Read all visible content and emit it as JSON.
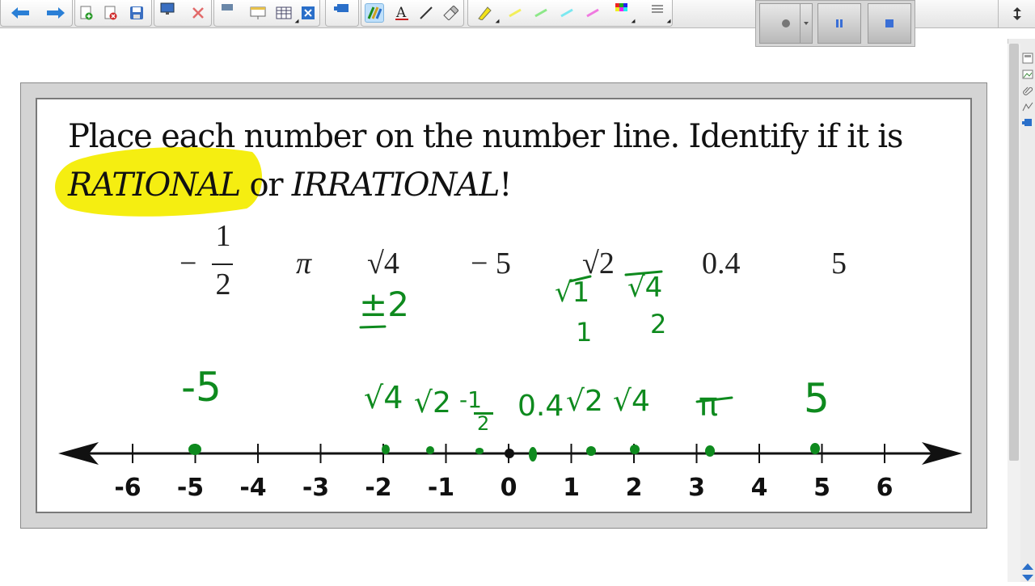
{
  "slide": {
    "title_line1": "Place each number on the number line. Identify if it is",
    "rational_word": "RATIONAL",
    "or_word": "or",
    "irrational_word": "IRRATIONAL",
    "exclamation": "!",
    "numbers": {
      "neg_half_sign": "−",
      "neg_half_num": "1",
      "neg_half_den": "2",
      "pi": "π",
      "sqrt4": "√4",
      "neg5": "− 5",
      "sqrt2": "√2",
      "zero_point_four": "0.4",
      "five": "5"
    },
    "number_line": {
      "tick_labels": [
        "-6",
        "-5",
        "-4",
        "-3",
        "-2",
        "-1",
        "0",
        "1",
        "2",
        "3",
        "4",
        "5",
        "6"
      ]
    },
    "handwriting": {
      "pm2": "±2",
      "sqrt1": "√1",
      "one": "1",
      "sqrt4_top": "√4",
      "two": "2",
      "neg5_label": "-5",
      "sqrt4_neg": "√4",
      "sqrt2_neg": "√2",
      "neg_half_label_num": "-1",
      "neg_half_label_den": "2",
      "point4_label": "0.4",
      "sqrt2_pos": "√2",
      "sqrt4_pos": "√4",
      "pi_label": "π",
      "five_label": "5"
    },
    "colors": {
      "ink": "#0e8a1e",
      "highlight": "#f5ee11"
    }
  },
  "icons": [
    "back-icon",
    "forward-icon",
    "add-page-icon",
    "delete-page-icon",
    "save-icon",
    "screen-icon",
    "delete-icon",
    "screen-shade-icon",
    "table-icon",
    "close-icon",
    "pen-icon",
    "text-icon",
    "line-icon",
    "eraser-icon",
    "highlighter-icon",
    "color-palette-icon",
    "record-icon",
    "pause-icon",
    "stop-icon",
    "expand-icon"
  ]
}
